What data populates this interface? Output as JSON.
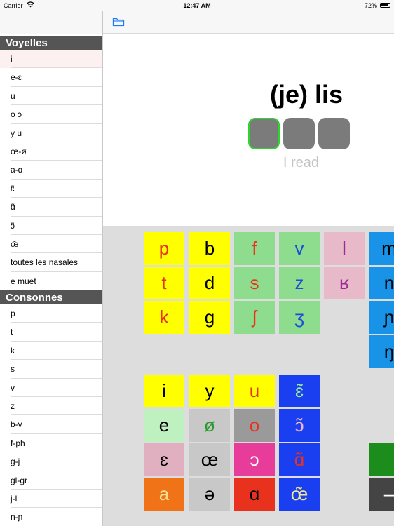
{
  "status": {
    "carrier": "Carrier",
    "time": "12:47 AM",
    "battery": "72%"
  },
  "sidebar": {
    "vowels_header": "Voyelles",
    "vowels": [
      "i",
      "e-ɛ",
      "u",
      "o ɔ",
      "y u",
      "œ-ø",
      "a-ɑ",
      "ɛ̃",
      "ɑ̃",
      "ɔ̃",
      "œ̃",
      "toutes les nasales",
      "e muet"
    ],
    "consonants_header": "Consonnes",
    "consonants": [
      "p",
      "t",
      "k",
      "s",
      "v",
      "z",
      "b-v",
      "f-ph",
      "g-j",
      "gl-gr",
      "j-l",
      "n-ɲ"
    ],
    "selected": "i"
  },
  "toolbar": {
    "icon": "folder-icon"
  },
  "word": {
    "text": "(je) lis",
    "syllable_count": 3,
    "active_syllable": 1,
    "translation": "I read",
    "active_color": "#2fd52f"
  },
  "keyboard": {
    "consonants": [
      {
        "symbol": "p",
        "bg": "#ffff00",
        "fg": "#e8321e"
      },
      {
        "symbol": "b",
        "bg": "#ffff00",
        "fg": "#000000"
      },
      {
        "symbol": "f",
        "bg": "#8edd8e",
        "fg": "#e8321e"
      },
      {
        "symbol": "v",
        "bg": "#8edd8e",
        "fg": "#1a4dd9"
      },
      {
        "symbol": "l",
        "bg": "#e8b9c8",
        "fg": "#9b2b95"
      },
      {
        "symbol": "m",
        "bg": "#1893e8",
        "fg": "#000000"
      },
      {
        "symbol": "t",
        "bg": "#ffff00",
        "fg": "#e8321e"
      },
      {
        "symbol": "d",
        "bg": "#ffff00",
        "fg": "#000000"
      },
      {
        "symbol": "s",
        "bg": "#8edd8e",
        "fg": "#e8321e"
      },
      {
        "symbol": "z",
        "bg": "#8edd8e",
        "fg": "#1a4dd9"
      },
      {
        "symbol": "ʁ",
        "bg": "#e8b9c8",
        "fg": "#9b2b95"
      },
      {
        "symbol": "n",
        "bg": "#1893e8",
        "fg": "#000000"
      },
      {
        "symbol": "k",
        "bg": "#ffff00",
        "fg": "#e8321e"
      },
      {
        "symbol": "g",
        "bg": "#ffff00",
        "fg": "#000000"
      },
      {
        "symbol": "ʃ",
        "bg": "#8edd8e",
        "fg": "#e8321e"
      },
      {
        "symbol": "ʒ",
        "bg": "#8edd8e",
        "fg": "#1a4dd9"
      },
      {
        "symbol": "ɲ",
        "bg": "#1893e8",
        "fg": "#000000"
      },
      {
        "symbol": "ŋ",
        "bg": "#1893e8",
        "fg": "#000000"
      }
    ],
    "vowels": [
      {
        "symbol": "i",
        "bg": "#ffff00",
        "fg": "#000000"
      },
      {
        "symbol": "y",
        "bg": "#ffff00",
        "fg": "#000000"
      },
      {
        "symbol": "u",
        "bg": "#ffff00",
        "fg": "#e8321e"
      },
      {
        "symbol": "ɛ̃",
        "bg": "#1a3ff0",
        "fg": "#9ae89a"
      },
      {
        "symbol": "e",
        "bg": "#bff0bf",
        "fg": "#000000"
      },
      {
        "symbol": "ø",
        "bg": "#c8c8c8",
        "fg": "#2a9a2a"
      },
      {
        "symbol": "o",
        "bg": "#9a9a9a",
        "fg": "#e8321e"
      },
      {
        "symbol": "ɔ̃",
        "bg": "#1a3ff0",
        "fg": "#f0b8d0"
      },
      {
        "symbol": "ɛ",
        "bg": "#e0b0c0",
        "fg": "#000000"
      },
      {
        "symbol": "œ",
        "bg": "#c8c8c8",
        "fg": "#000000"
      },
      {
        "symbol": "ɔ",
        "bg": "#e83c9a",
        "fg": "#ffffff"
      },
      {
        "symbol": "ɑ̃",
        "bg": "#1a3ff0",
        "fg": "#e8321e"
      },
      {
        "symbol": "a",
        "bg": "#f07318",
        "fg": "#f5e090"
      },
      {
        "symbol": "ə",
        "bg": "#c8c8c8",
        "fg": "#000000"
      },
      {
        "symbol": "ɑ",
        "bg": "#e8321e",
        "fg": "#000000"
      },
      {
        "symbol": "œ̃",
        "bg": "#1a3ff0",
        "fg": "#f0e890"
      }
    ],
    "extra": [
      {
        "symbol": "",
        "bg": "#1c8c1c",
        "fg": "#ffffff"
      },
      {
        "symbol": "–",
        "bg": "#444444",
        "fg": "#ffffff"
      }
    ]
  }
}
